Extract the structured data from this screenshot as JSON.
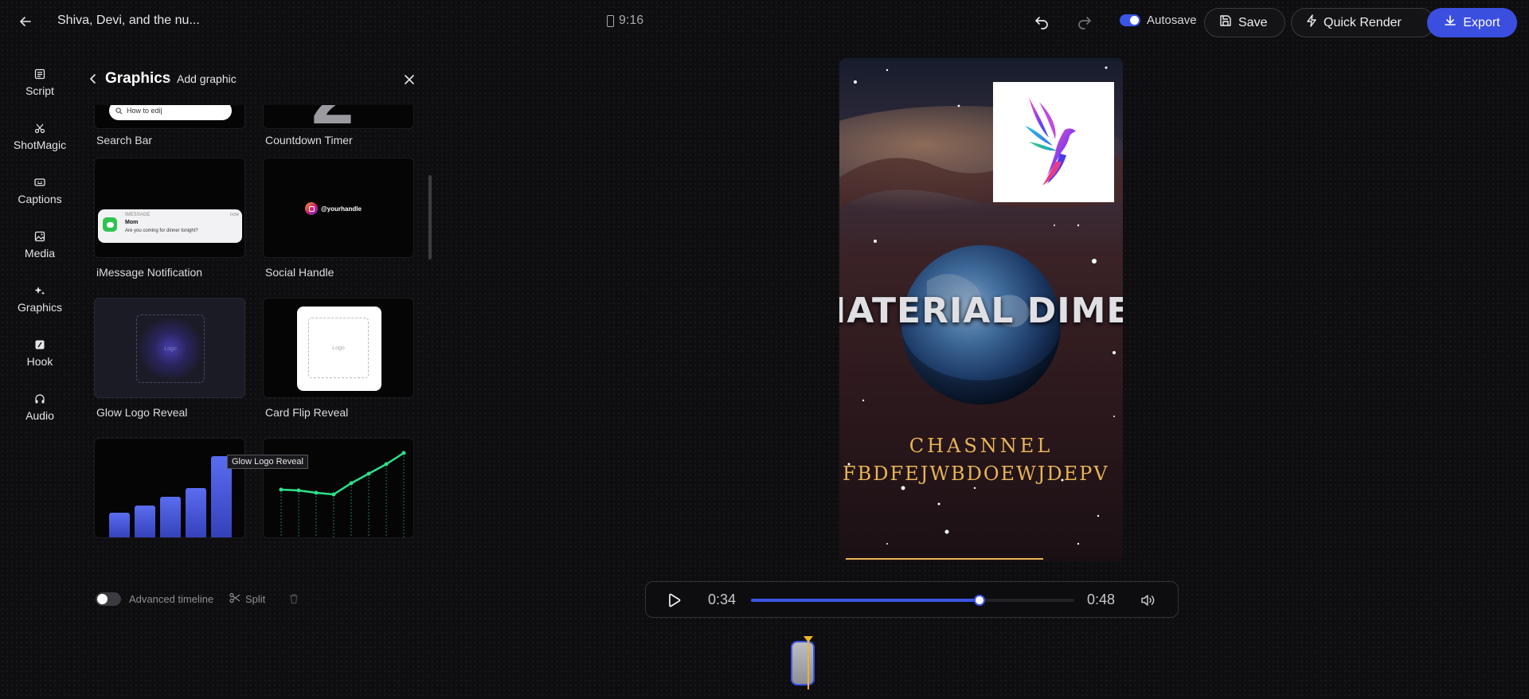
{
  "header": {
    "project_title": "Shiva, Devi, and the nu...",
    "aspect_ratio": "9:16",
    "autosave_label": "Autosave",
    "autosave_on": true,
    "save_label": "Save",
    "quick_render_label": "Quick Render",
    "export_label": "Export"
  },
  "sidebar": {
    "items": [
      {
        "label": "Script",
        "icon": "script-icon"
      },
      {
        "label": "ShotMagic",
        "icon": "scissors-icon"
      },
      {
        "label": "Captions",
        "icon": "captions-icon"
      },
      {
        "label": "Media",
        "icon": "image-icon"
      },
      {
        "label": "Graphics",
        "icon": "sparkle-icon"
      },
      {
        "label": "Hook",
        "icon": "hook-icon"
      },
      {
        "label": "Audio",
        "icon": "headphones-icon"
      }
    ]
  },
  "panel": {
    "title": "Graphics",
    "separator": "›",
    "crumb": "Add graphic",
    "cards": [
      {
        "label": "Search Bar",
        "thumb_text": "How to edi|"
      },
      {
        "label": "Countdown Timer",
        "thumb_text": "2"
      },
      {
        "label": "iMessage Notification",
        "thumb_app": "IMESSAGE",
        "thumb_time": "now",
        "thumb_sender": "Mom",
        "thumb_message": "Are you coming for dinner tonight?"
      },
      {
        "label": "Social Handle",
        "thumb_text": "@yourhandle"
      },
      {
        "label": "Glow Logo Reveal",
        "thumb_text": "Logo"
      },
      {
        "label": "Card Flip Reveal",
        "thumb_text": "Logo"
      },
      {
        "label": "",
        "thumb_kind": "bar-chart"
      },
      {
        "label": "",
        "thumb_kind": "line-chart"
      }
    ],
    "tooltip": "Glow Logo Reveal"
  },
  "timeline_controls": {
    "advanced_label": "Advanced timeline",
    "advanced_on": false,
    "split_label": "Split"
  },
  "preview": {
    "headline": "IATERIAL DIMENS",
    "subtitle_line1": "CHASNNEL",
    "subtitle_line2": "FBDFEJWBDOEWJDEPV",
    "accent_color": "#e7b458"
  },
  "player": {
    "current_time": "0:34",
    "total_time": "0:48",
    "progress_fraction": 0.708
  },
  "colors": {
    "primary": "#3b55e6",
    "playhead": "#f0b429"
  }
}
